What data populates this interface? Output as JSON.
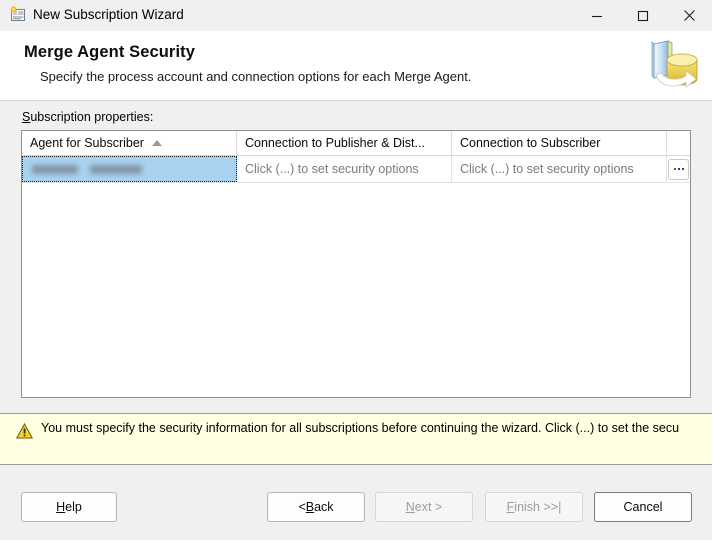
{
  "window": {
    "title": "New Subscription Wizard",
    "icon": "subscription-wizard-icon",
    "controls": {
      "minimize": "minimize-icon",
      "maximize": "maximize-icon",
      "close": "close-icon"
    }
  },
  "header": {
    "title": "Merge Agent Security",
    "subtitle": "Specify the process account and connection options for each Merge Agent.",
    "icon": "replication-book-database-icon"
  },
  "content": {
    "properties_label": "Subscription properties:",
    "properties_label_accel": "S",
    "properties_label_rest": "ubscription properties:",
    "grid": {
      "columns": [
        {
          "label": "Agent for Subscriber",
          "sorted": "ascending"
        },
        {
          "label": "Connection to Publisher & Dist...",
          "sorted": "none"
        },
        {
          "label": "Connection to Subscriber",
          "sorted": "none"
        },
        {
          "label": "",
          "sorted": "none"
        }
      ],
      "rows": [
        {
          "selected": true,
          "agent_for_subscriber": "",
          "agent_for_subscriber_redacted": true,
          "connection_to_publisher": "Click (...) to set security options",
          "connection_to_subscriber": "Click (...) to set security options",
          "action_button": "..."
        }
      ]
    }
  },
  "warning": {
    "icon": "warning-triangle-icon",
    "text": "You must specify the security information for all subscriptions before continuing the wizard. Click (...) to set the secu"
  },
  "footer": {
    "buttons": [
      {
        "id": "help",
        "label_accel": "H",
        "label_prefix": "",
        "label_rest": "elp",
        "disabled": false,
        "default": false
      },
      {
        "id": "back",
        "label_accel": "B",
        "label_prefix": "< ",
        "label_rest": "ack",
        "disabled": false,
        "default": false
      },
      {
        "id": "next",
        "label_accel": "N",
        "label_prefix": "",
        "label_rest": "ext >",
        "disabled": true,
        "default": false
      },
      {
        "id": "finish",
        "label_accel": "F",
        "label_prefix": "",
        "label_rest": "inish >>|",
        "disabled": true,
        "default": false
      },
      {
        "id": "cancel",
        "label_accel": "",
        "label_prefix": "Cancel",
        "label_rest": "",
        "disabled": false,
        "default": true
      }
    ]
  },
  "colors": {
    "selection_blue": "#a8d2f0",
    "warning_bg": "#ffffe1",
    "dialog_bg": "#f0f0f0",
    "panel_bg": "#ffffff"
  }
}
